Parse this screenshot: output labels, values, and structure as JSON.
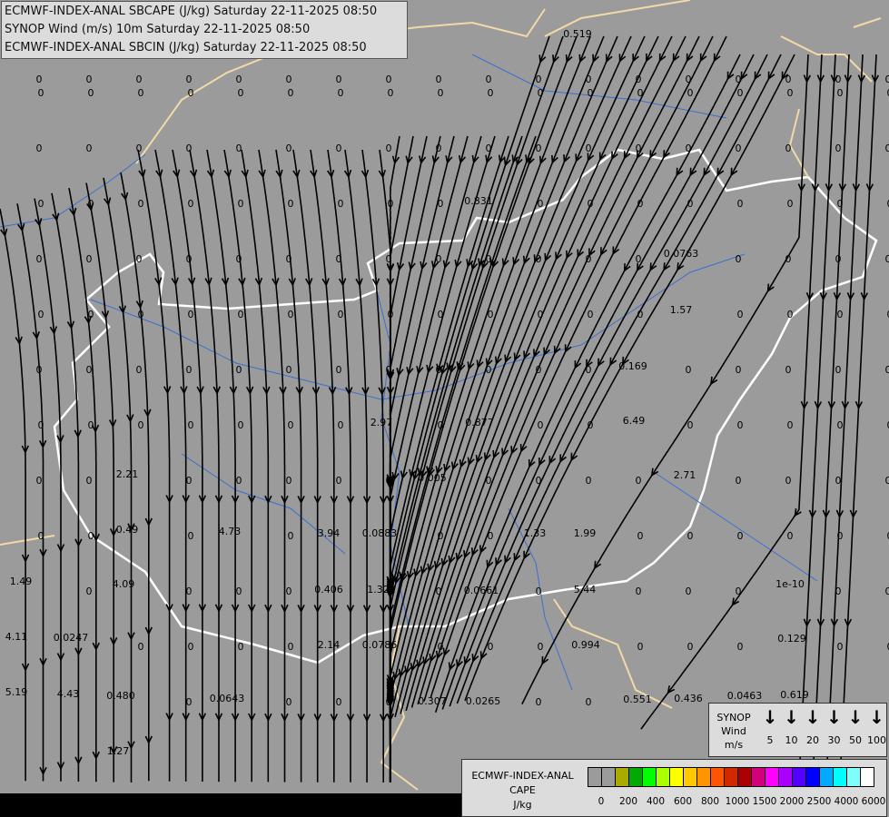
{
  "header": {
    "lines": [
      "ECMWF-INDEX-ANAL SBCAPE (J/kg) Saturday 22-11-2025 08:50",
      "SYNOP Wind (m/s) 10m Saturday 22-11-2025 08:50",
      "ECMWF-INDEX-ANAL SBCIN (J/kg) Saturday 22-11-2025 08:50"
    ]
  },
  "map": {
    "background_color": "#9b9b9b",
    "country_border_color": "#f2d9a8",
    "highlight_border_color": "#ffffff",
    "river_color": "#3a6fd0",
    "streamline_color": "#000000",
    "zero_label": "0",
    "values": [
      "0.519",
      "0.831",
      "0.0763",
      "1.57",
      "0.169",
      "2.97",
      "0.877",
      "6.49",
      "2.21",
      "0.005",
      "2.71",
      "0.49",
      "4.73",
      "3.94",
      "0.0883",
      "1.33",
      "1.99",
      "1.49",
      "4.09",
      "0.406",
      "1.322",
      "0.0661",
      "5.44",
      "1e-10",
      "4.11",
      "0.0247",
      "2.14",
      "0.0786",
      "0.994",
      "0.129",
      "5.19",
      "4.43",
      "0.480",
      "0.0643",
      "0.307",
      "0.0265",
      "0.551",
      "0.436",
      "0.0463",
      "0.619",
      "1.27"
    ]
  },
  "wind_legend": {
    "title_lines": [
      "SYNOP",
      "Wind",
      "m/s"
    ],
    "speeds": [
      "5",
      "10",
      "20",
      "30",
      "50",
      "100"
    ],
    "arrow_icon": "down-arrow"
  },
  "cape_legend": {
    "title_lines": [
      "ECMWF-INDEX-ANAL",
      "CAPE",
      "J/kg"
    ],
    "colors": [
      "#9b9b9b",
      "#9b9b9b",
      "#aaaa00",
      "#00aa00",
      "#00ff00",
      "#aaff00",
      "#ffff00",
      "#ffc800",
      "#ff9600",
      "#ff5500",
      "#d22800",
      "#aa0000",
      "#d2007d",
      "#ff00ff",
      "#aa00ff",
      "#5500ff",
      "#0000ff",
      "#00aaff",
      "#00ffff",
      "#80ffff",
      "#ffffff"
    ],
    "tick_labels": [
      "0",
      "200",
      "400",
      "600",
      "800",
      "1000",
      "1500",
      "2000",
      "2500",
      "4000",
      "6000"
    ]
  }
}
